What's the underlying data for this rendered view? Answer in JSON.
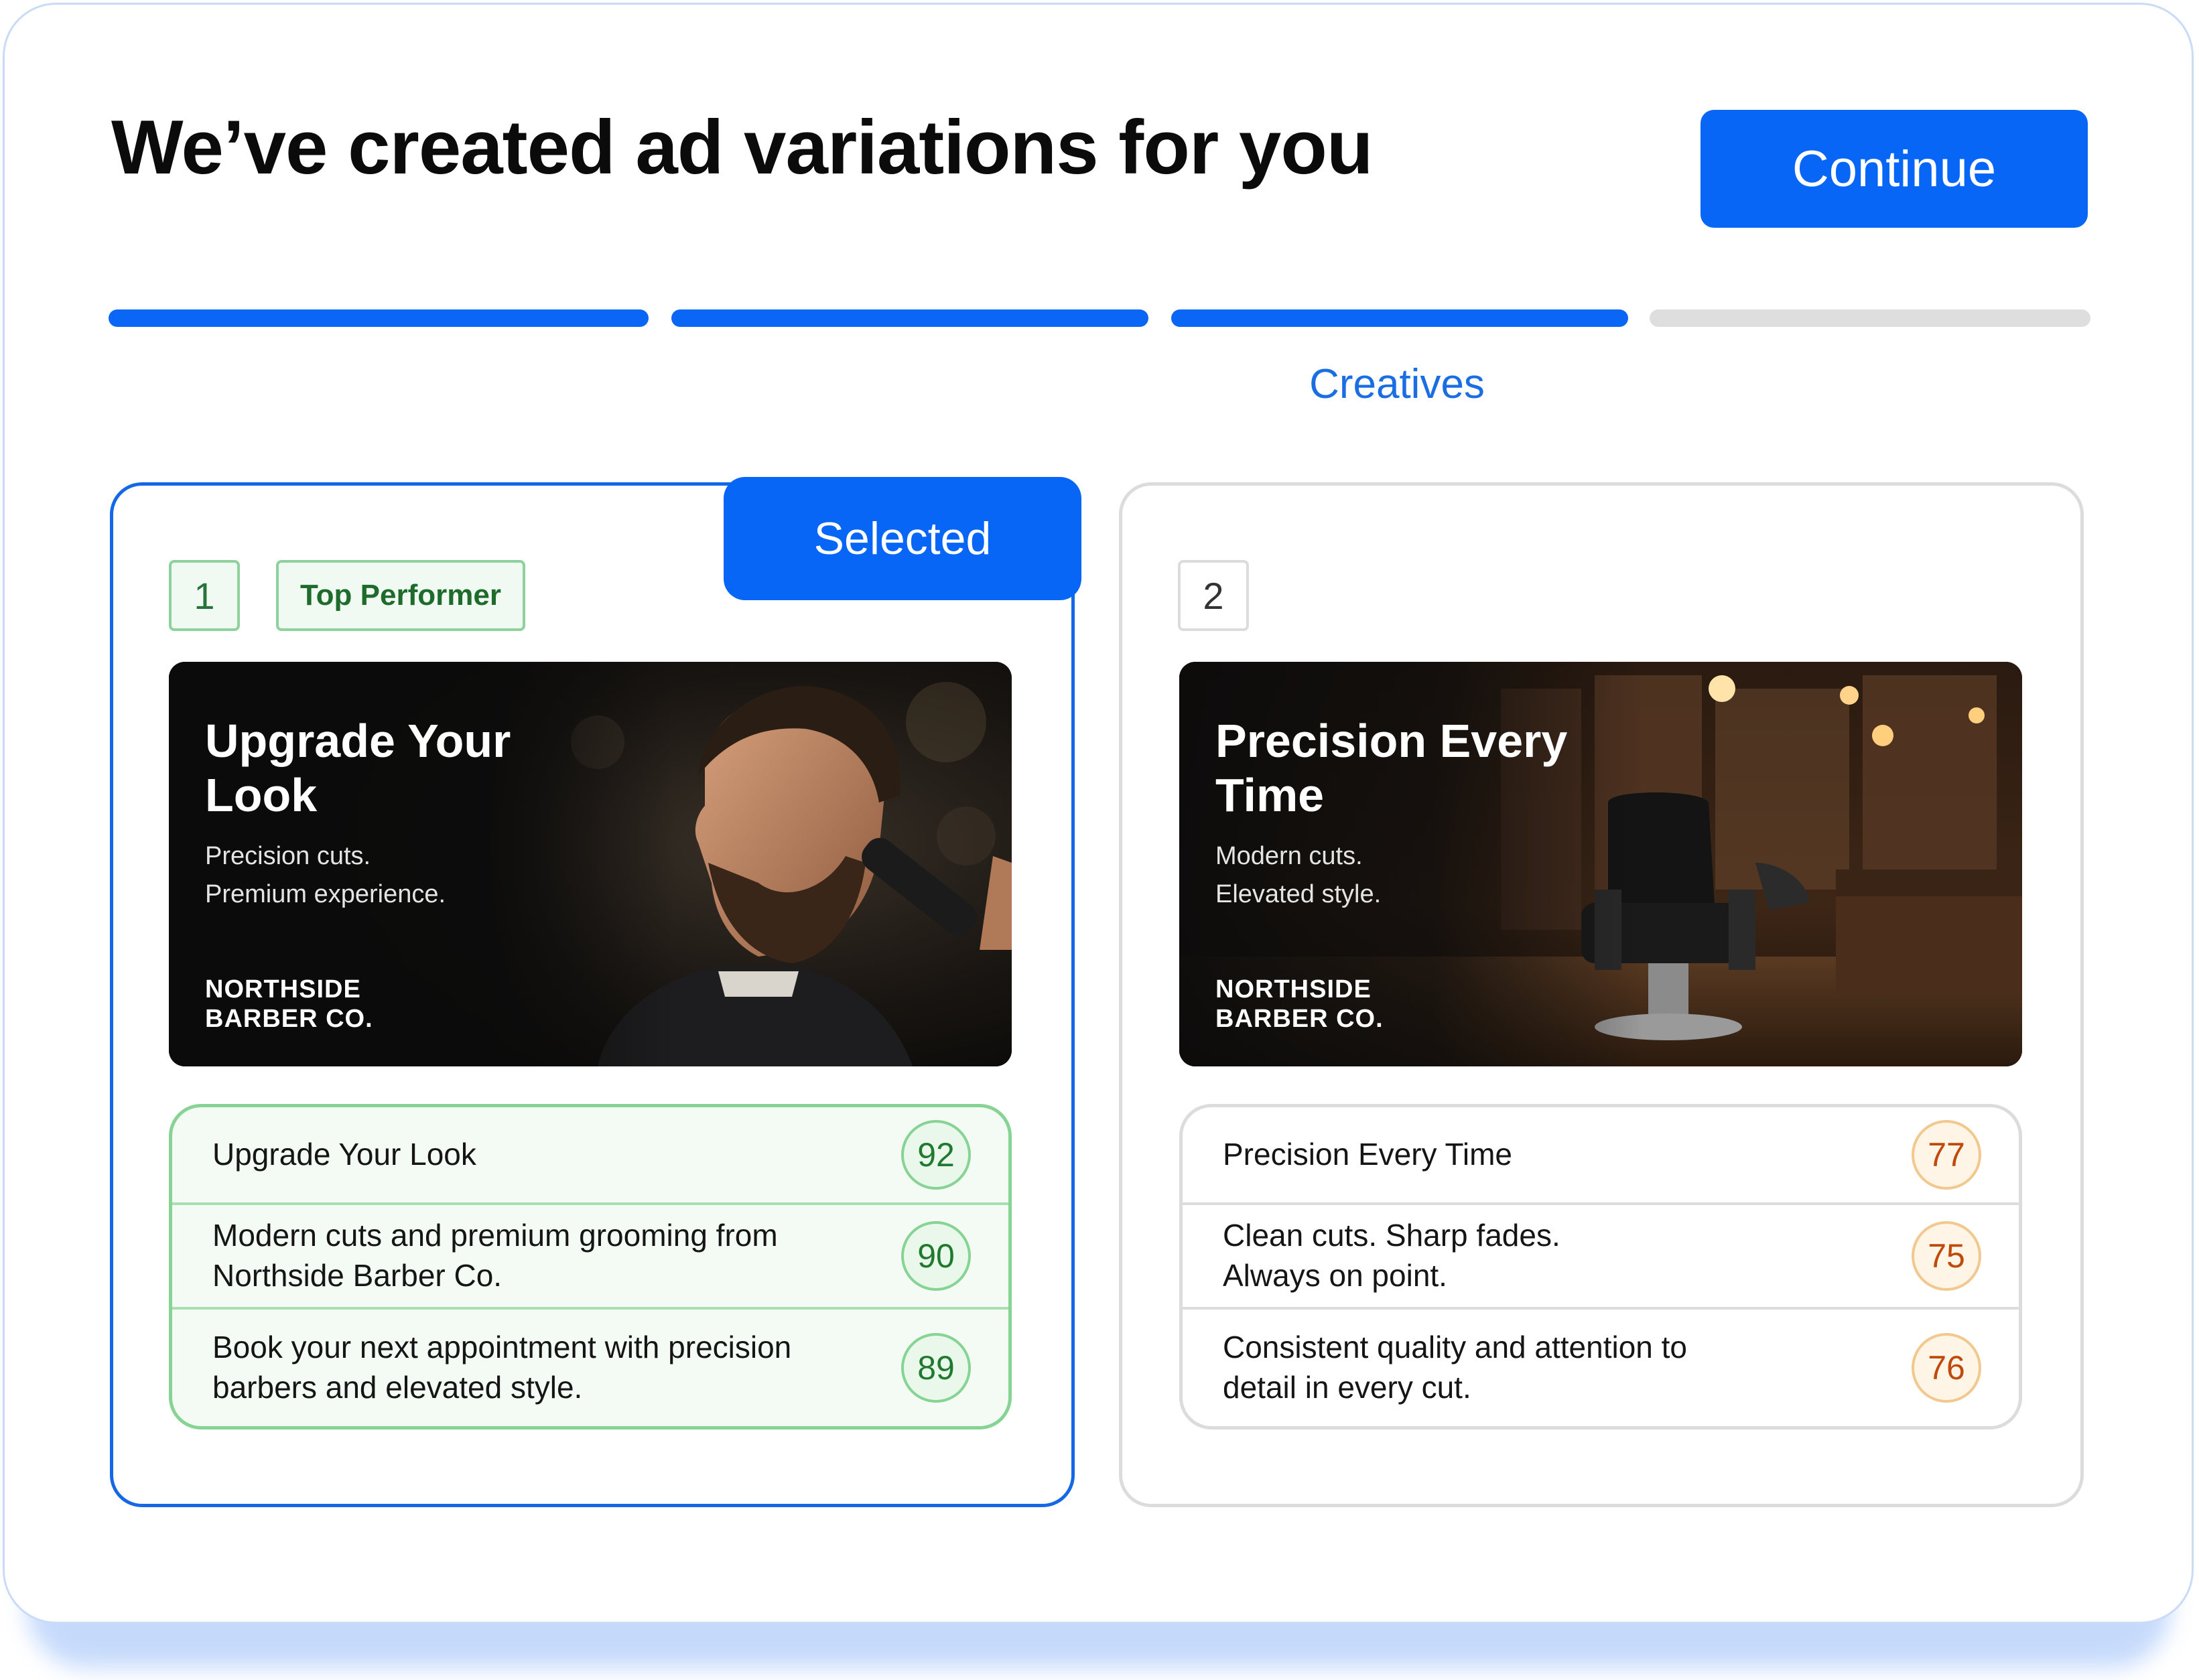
{
  "header": {
    "title": "We’ve created ad variations for you",
    "continue_label": "Continue"
  },
  "progress": {
    "total_steps": 4,
    "completed_steps": 3,
    "current_step_label": "Creatives"
  },
  "colors": {
    "accent": "#0866f7",
    "success": "#86d394",
    "warning": "#f2c88e"
  },
  "variations": [
    {
      "number": "1",
      "selected": true,
      "selected_label": "Selected",
      "badge": "Top Performer",
      "creative": {
        "headline": "Upgrade Your Look",
        "subline_1": "Precision cuts.",
        "subline_2": "Premium experience.",
        "brand_1": "NORTHSIDE",
        "brand_2": "BARBER CO.",
        "image": "bearded man getting a haircut with clippers"
      },
      "copy": [
        {
          "text": "Upgrade Your Look",
          "score": "92"
        },
        {
          "text": "Modern cuts and premium grooming from Northside Barber Co.",
          "score": "90"
        },
        {
          "text": "Book your next appointment with precision barbers and elevated style.",
          "score": "89"
        }
      ]
    },
    {
      "number": "2",
      "selected": false,
      "creative": {
        "headline": "Precision Every Time",
        "subline_1": "Modern cuts.",
        "subline_2": "Elevated style.",
        "brand_1": "NORTHSIDE",
        "brand_2": "BARBER CO.",
        "image": "barbershop interior with leather barber chair"
      },
      "copy": [
        {
          "text": "Precision Every Time",
          "score": "77"
        },
        {
          "text": "Clean cuts. Sharp fades. Always on point.",
          "score": "75"
        },
        {
          "text": "Consistent quality and attention to detail in every cut.",
          "score": "76"
        }
      ]
    }
  ]
}
